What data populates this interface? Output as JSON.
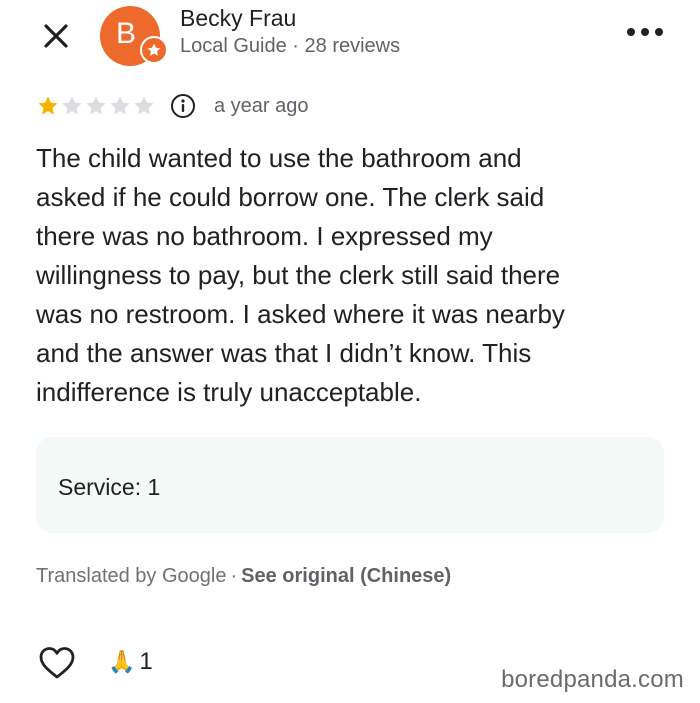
{
  "reviewer": {
    "initial": "B",
    "name": "Becky Frau",
    "meta": "Local Guide · 28 reviews",
    "avatar_color": "#ee6a2c"
  },
  "rating": {
    "stars": 1,
    "max_stars": 5,
    "filled_color": "#f5b400",
    "empty_color": "#dadce0"
  },
  "time_ago": "a year ago",
  "review_lines": [
    "The child wanted to use the bathroom and",
    "asked if he could borrow one. The clerk said",
    "there was no bathroom. I expressed my",
    "willingness to pay, but the clerk still said there",
    "was no restroom. I asked where it was nearby",
    "and the answer was that I didn’t know. This",
    "indifference is truly unacceptable."
  ],
  "service": "Service: 1",
  "translation": {
    "label": "Translated by Google",
    "separator": "·",
    "see_original": "See original (Chinese)"
  },
  "reactions": {
    "emoji": "🙏",
    "count": "1"
  },
  "icons": {
    "close": "close-icon",
    "more": "more-horizontal-icon",
    "info": "info-icon",
    "like": "heart-outline-icon",
    "badge": "local-guide-star-icon"
  },
  "watermark": "boredpanda.com"
}
